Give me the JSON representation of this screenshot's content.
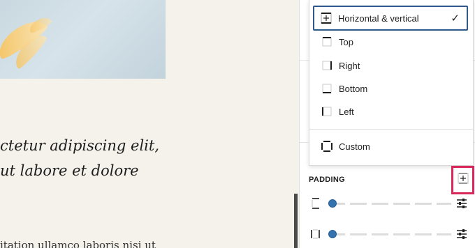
{
  "canvas": {
    "line1": "ctetur adipiscing elit,",
    "line2": "ut labore et dolore",
    "line3": "itation ullamco laboris nisi ut"
  },
  "dropdown": {
    "items": [
      {
        "label": "Horizontal & vertical",
        "icon": "sides-axial-icon",
        "selected": true
      },
      {
        "label": "Top",
        "icon": "side-top-icon",
        "selected": false
      },
      {
        "label": "Right",
        "icon": "side-right-icon",
        "selected": false
      },
      {
        "label": "Bottom",
        "icon": "side-bottom-icon",
        "selected": false
      },
      {
        "label": "Left",
        "icon": "side-left-icon",
        "selected": false
      },
      {
        "label": "Custom",
        "icon": "sides-custom-icon",
        "selected": false
      }
    ],
    "check": "✓"
  },
  "padding": {
    "label": "PADDING",
    "rows": [
      {
        "icon": "side-vertical-icon",
        "value": 0
      },
      {
        "icon": "side-horizontal-icon",
        "value": 0
      }
    ]
  },
  "colors": {
    "accent": "#3572b0",
    "highlight": "#d8285a",
    "selected_border": "#2d5a8a"
  }
}
